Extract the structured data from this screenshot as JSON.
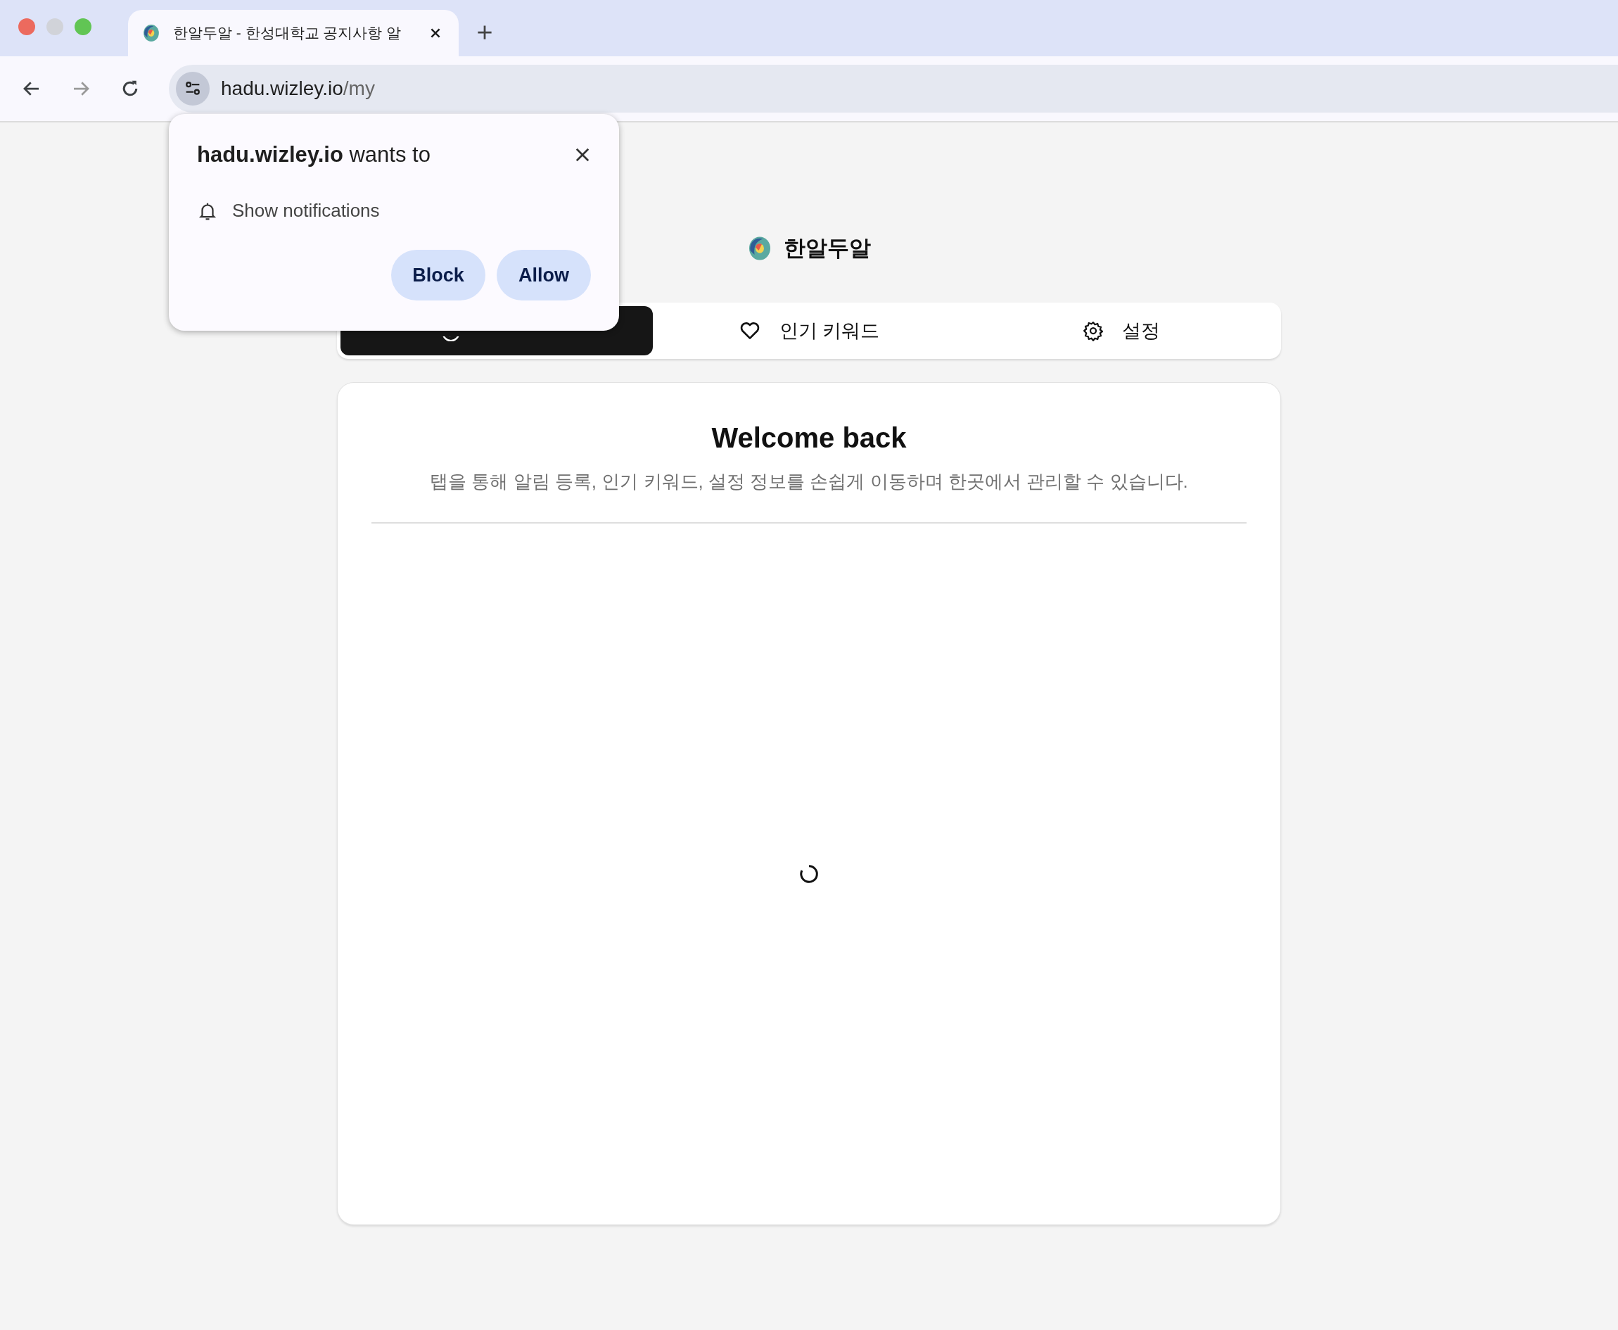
{
  "browser": {
    "tab_title": "한알두알 - 한성대학교 공지사항 알",
    "url_host": "hadu.wizley.io",
    "url_path": "/my"
  },
  "permission_popup": {
    "title": "**hadu.wizley.io** wants to",
    "permission": "Show notifications",
    "buttons": [
      "Block",
      "Allow"
    ]
  },
  "app": {
    "name": "한알두알"
  },
  "tabs": [
    {
      "kind": "alerts",
      "selected": true
    },
    {
      "kind": "popular",
      "label": "인기 키워드",
      "selected": false
    },
    {
      "kind": "settings",
      "label": "설정",
      "selected": false
    }
  ],
  "card": {
    "title": "Welcome back",
    "subtitle": "탭을 통해 알림 등록, 인기 키워드, 설정 정보를 손쉽게 이동하며 한곳에서 관리할 수 있습니다.",
    "loading": true
  }
}
